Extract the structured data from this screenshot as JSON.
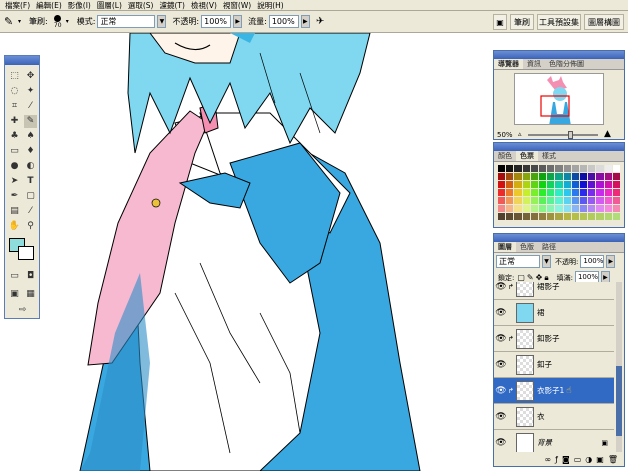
{
  "menubar": {
    "items": [
      "檔案(F)",
      "編輯(E)",
      "影像(I)",
      "圖層(L)",
      "選取(S)",
      "濾鏡(T)",
      "檢視(V)",
      "視窗(W)",
      "說明(H)"
    ]
  },
  "options": {
    "brush_label": "筆刷:",
    "brush_size": "70",
    "mode_label": "模式:",
    "mode_value": "正常",
    "opacity_label": "不透明:",
    "opacity_value": "100%",
    "flow_label": "流量:",
    "flow_value": "100%",
    "right_tabs": [
      "筆刷",
      "工具預設集",
      "圖層構圖"
    ]
  },
  "navigator": {
    "tabs": [
      "導覽器",
      "資訊",
      "色階分佈圖"
    ],
    "zoom": "50%"
  },
  "swatches": {
    "tabs": [
      "顏色",
      "色票",
      "樣式"
    ]
  },
  "layers": {
    "tabs": [
      "圖層",
      "色版",
      "路徑"
    ],
    "blend_mode": "正常",
    "opacity_label": "不透明:",
    "opacity_value": "100%",
    "lock_label": "鎖定:",
    "fill_label": "填滿:",
    "fill_value": "100%",
    "items": [
      {
        "name": "裙影子",
        "selected": false,
        "clipped": true
      },
      {
        "name": "裙",
        "selected": false,
        "clipped": false
      },
      {
        "name": "釦影子",
        "selected": false,
        "clipped": true
      },
      {
        "name": "釦子",
        "selected": false,
        "clipped": false
      },
      {
        "name": "衣影子1",
        "selected": true,
        "clipped": true
      },
      {
        "name": "衣",
        "selected": false,
        "clipped": false
      },
      {
        "name": "背景",
        "selected": false,
        "clipped": false
      }
    ]
  },
  "colors": {
    "ui_bg": "#ece9d8",
    "selection": "#316ac5",
    "hair": "#7fd8f0",
    "hair_dark": "#3bb6e4",
    "dress": "#3aa8e0",
    "tie": "#f7b9d0",
    "foreground_swatch": "#8fdcdc"
  }
}
